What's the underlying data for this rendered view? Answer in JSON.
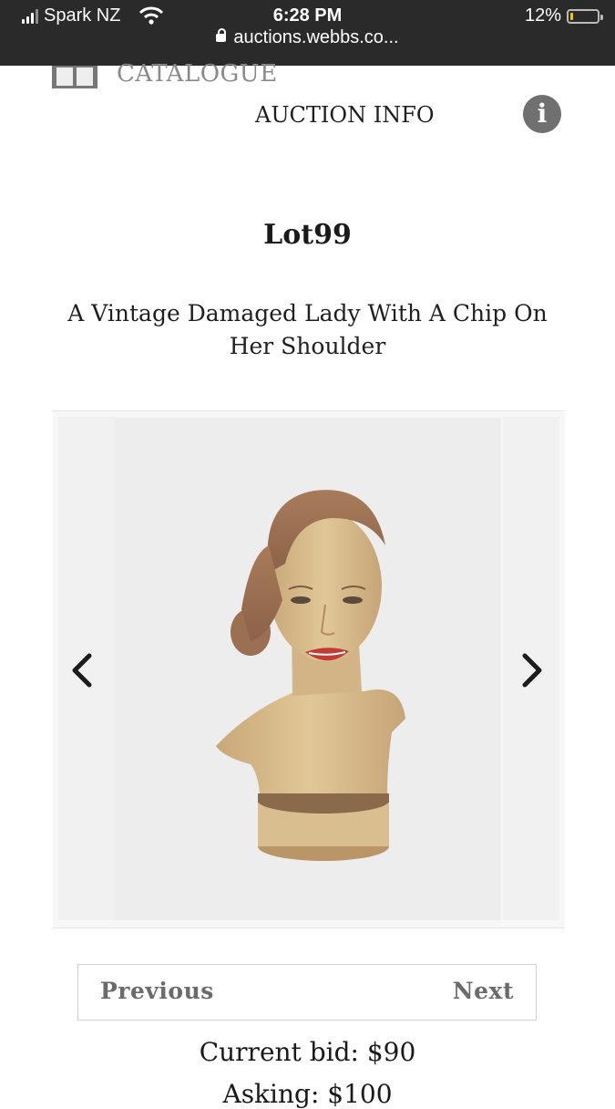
{
  "status_bar": {
    "carrier": "Spark NZ",
    "time": "6:28 PM",
    "battery": "12%",
    "battery_level": 0.12,
    "url": "auctions.webbs.co..."
  },
  "header": {
    "catalogue_label": "CATALOGUE",
    "auction_info_label": "AUCTION INFO",
    "info_icon": "i"
  },
  "lot": {
    "title": "Lot99",
    "description": "A Vintage Damaged Lady With A Chip On Her Shoulder"
  },
  "carousel": {
    "image_subject": "vintage mannequin bust of a lady",
    "prev_icon": "chevron-left-icon",
    "next_icon": "chevron-right-icon"
  },
  "pager": {
    "previous_label": "Previous",
    "next_label": "Next"
  },
  "bidding": {
    "current_bid": "Current bid: $90",
    "asking": "Asking: $100"
  },
  "colors": {
    "topbar": "#2a2a2a",
    "info_icon": "#707070",
    "pager_text": "#6b6b6b"
  }
}
